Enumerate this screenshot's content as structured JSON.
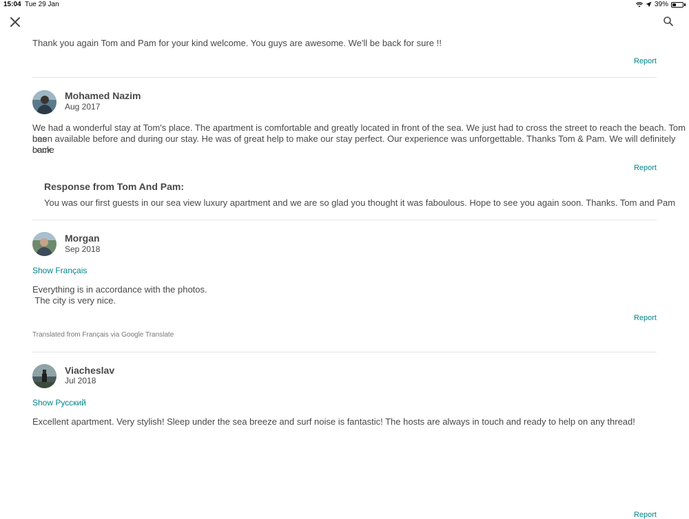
{
  "status": {
    "time": "15:04",
    "date": "Tue 29 Jan",
    "battery": "39%",
    "battery_level": 0.39
  },
  "reviews_top": {
    "partial_text": "Thank you again Tom and Pam for your kind welcome. You guys are awesome. We'll be back for sure !!",
    "report": "Report"
  },
  "review1": {
    "name": "Mohamed Nazim",
    "date": "Aug 2017",
    "text_line1": "We had a wonderful stay at Tom's place. The apartment is comfortable and greatly located in front of the sea. We just had to cross the street to reach the beach. Tom has",
    "text_line2": "been available before and during our stay. He was of great help to make our stay perfect. Our experience was unforgettable. Thanks Tom & Pam. We will definitely come",
    "text_line3": "back.",
    "report": "Report",
    "response_title": "Response from Tom And Pam:",
    "response_text": "You was our first guests in our sea view luxury apartment and we are so glad you thought it was faboulous. Hope to see you again soon. Thanks. Tom and Pam"
  },
  "review2": {
    "name": "Morgan",
    "date": "Sep 2018",
    "show_original": "Show Français",
    "text_line1": "Everything is in accordance with the photos.",
    "text_line2": " The city is very nice.",
    "report": "Report",
    "translated_note": "Translated from Français via Google Translate"
  },
  "review3": {
    "name": "Viacheslav",
    "date": "Jul 2018",
    "show_original": "Show Русский",
    "text": "Excellent apartment. Very stylish! Sleep under the sea breeze and surf noise is fantastic! The hosts are always in touch and ready to help on any thread!",
    "report": "Report"
  }
}
